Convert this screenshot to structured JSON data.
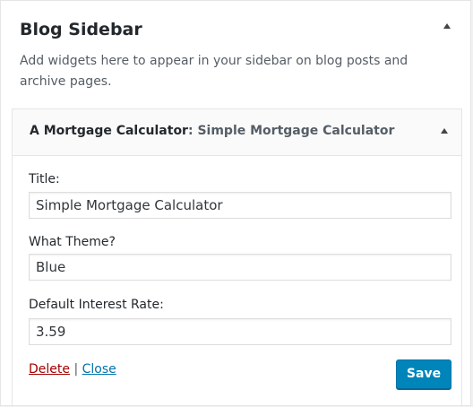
{
  "sidebar": {
    "title": "Blog Sidebar",
    "description": "Add widgets here to appear in your sidebar on blog posts and archive pages."
  },
  "widget": {
    "name": "A Mortgage Calculator",
    "title_separator": ": ",
    "instance_title": "Simple Mortgage Calculator",
    "fields": [
      {
        "label": "Title:",
        "value": "Simple Mortgage Calculator"
      },
      {
        "label": "What Theme?",
        "value": "Blue"
      },
      {
        "label": "Default Interest Rate:",
        "value": "3.59"
      }
    ],
    "delete_label": "Delete",
    "separator": " | ",
    "close_label": "Close",
    "save_label": "Save"
  },
  "colors": {
    "primary_button": "#0085ba",
    "delete_link": "#a00000",
    "close_link": "#0073aa"
  }
}
